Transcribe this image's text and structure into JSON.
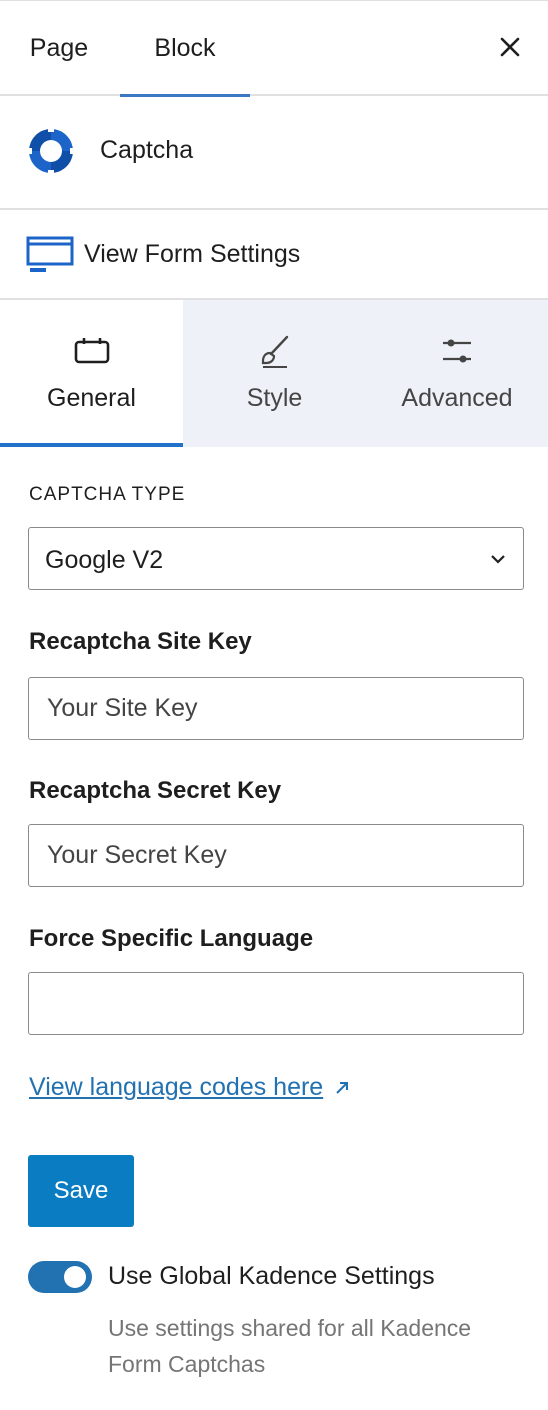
{
  "top_tabs": {
    "page_label": "Page",
    "block_label": "Block",
    "active": "Block"
  },
  "icons": {
    "close": "close-icon",
    "block": "kadence-captcha-logo-icon",
    "form_settings": "form-window-icon",
    "general": "general-tab-icon",
    "style": "paintbrush-icon",
    "advanced": "sliders-icon",
    "external": "external-link-icon"
  },
  "block": {
    "title": "Captcha"
  },
  "form_settings": {
    "label": "View Form Settings"
  },
  "panel_tabs": [
    {
      "label": "General",
      "active": true
    },
    {
      "label": "Style",
      "active": false
    },
    {
      "label": "Advanced",
      "active": false
    }
  ],
  "captcha": {
    "type_label": "CAPTCHA TYPE",
    "type_value": "Google V2"
  },
  "site_key": {
    "label": "Recaptcha Site Key",
    "placeholder": "Your Site Key",
    "value": ""
  },
  "secret_key": {
    "label": "Recaptcha Secret Key",
    "placeholder": "Your Secret Key",
    "value": ""
  },
  "language": {
    "label": "Force Specific Language",
    "value": ""
  },
  "language_link": {
    "label": "View language codes here"
  },
  "save": {
    "label": "Save"
  },
  "global_toggle": {
    "label": "Use Global Kadence Settings",
    "help": "Use settings shared for all Kadence Form Captchas",
    "enabled": true
  },
  "colors": {
    "accent": "#2271b1",
    "save_button": "#0a7dc2",
    "tab_active_underline": "#2073c8",
    "inactive_tab_bg": "#eef2f8",
    "logo_blue": "#1c64c8"
  }
}
